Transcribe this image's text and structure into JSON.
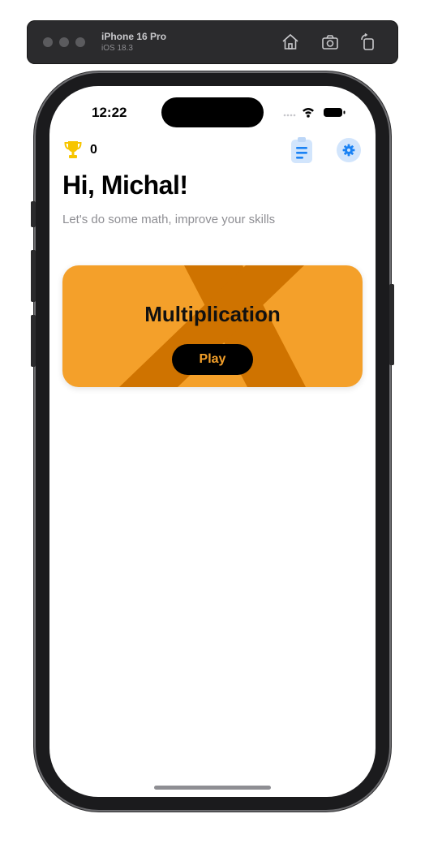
{
  "simulator": {
    "device_name": "iPhone 16 Pro",
    "os_version": "iOS 18.3"
  },
  "status_bar": {
    "time": "12:22"
  },
  "header": {
    "score": "0"
  },
  "greeting": {
    "title": "Hi, Michal!",
    "subtitle": "Let's do some math, improve your skills"
  },
  "game_card": {
    "title": "Multiplication",
    "play_label": "Play",
    "accent_color": "#f4a02a",
    "x_color": "#cf7300"
  },
  "icons": [
    "home-icon",
    "screenshot-icon",
    "rotate-icon",
    "trophy-icon",
    "clipboard-icon",
    "gear-icon",
    "wifi-icon",
    "battery-icon",
    "signal-icon"
  ]
}
